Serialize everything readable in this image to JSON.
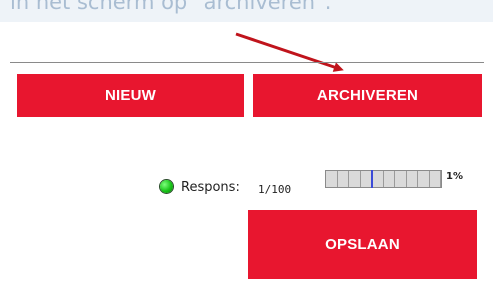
{
  "caption": {
    "text": "in het scherm op \"archiveren\"."
  },
  "buttons": {
    "new_label": "NIEUW",
    "archive_label": "ARCHIVEREN",
    "save_label": "OPSLAAN"
  },
  "response": {
    "label": "Respons:",
    "value": "1/100",
    "percent": "1%",
    "progress_fraction": 0.01,
    "segments": 10,
    "status": "green"
  },
  "colors": {
    "button_bg": "#e8162f",
    "button_text": "#ffffff",
    "arrow": "#c0141c",
    "marker": "#3b4bd8"
  },
  "icons": {
    "arrow": "arrow-pointer-icon",
    "status": "status-dot-icon"
  }
}
